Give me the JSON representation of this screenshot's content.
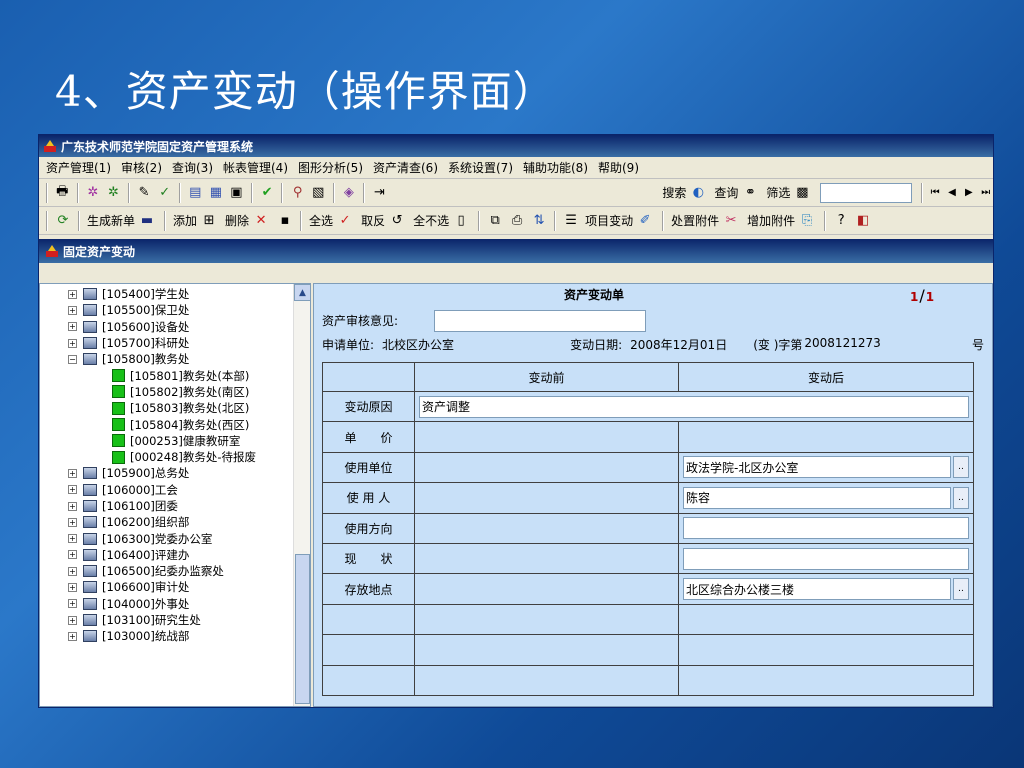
{
  "slide": {
    "title": "4、资产变动（操作界面）"
  },
  "window": {
    "title": "广东技术师范学院固定资产管理系统"
  },
  "menu": [
    "资产管理(1)",
    "审核(2)",
    "查询(3)",
    "帐表管理(4)",
    "图形分析(5)",
    "资产清查(6)",
    "系统设置(7)",
    "辅助功能(8)",
    "帮助(9)"
  ],
  "toolbar1": {
    "search_label": "搜索",
    "query_label": "查询",
    "filter_label": "筛选",
    "search_value": ""
  },
  "toolbar2": {
    "buttons": [
      "生成新单",
      "添加",
      "删除",
      "全选",
      "取反",
      "全不选",
      "项目变动",
      "处置附件",
      "增加附件"
    ]
  },
  "subwindow": {
    "title": "固定资产变动"
  },
  "tree": {
    "nodes": [
      {
        "label": "[105400]学生处",
        "type": "folder",
        "expand": "+"
      },
      {
        "label": "[105500]保卫处",
        "type": "folder",
        "expand": "+"
      },
      {
        "label": "[105600]设备处",
        "type": "folder",
        "expand": "+"
      },
      {
        "label": "[105700]科研处",
        "type": "folder",
        "expand": "+"
      },
      {
        "label": "[105800]教务处",
        "type": "folder",
        "expand": "−"
      },
      {
        "label": "[105801]教务处(本部)",
        "type": "leaf"
      },
      {
        "label": "[105802]教务处(南区)",
        "type": "leaf"
      },
      {
        "label": "[105803]教务处(北区)",
        "type": "leaf"
      },
      {
        "label": "[105804]教务处(西区)",
        "type": "leaf"
      },
      {
        "label": "[000253]健康教研室",
        "type": "leaf"
      },
      {
        "label": "[000248]教务处-待报废",
        "type": "leaf"
      },
      {
        "label": "[105900]总务处",
        "type": "folder",
        "expand": "+"
      },
      {
        "label": "[106000]工会",
        "type": "folder",
        "expand": "+"
      },
      {
        "label": "[106100]团委",
        "type": "folder",
        "expand": "+"
      },
      {
        "label": "[106200]组织部",
        "type": "folder",
        "expand": "+"
      },
      {
        "label": "[106300]党委办公室",
        "type": "folder",
        "expand": "+"
      },
      {
        "label": "[106400]评建办",
        "type": "folder",
        "expand": "+"
      },
      {
        "label": "[106500]纪委办监察处",
        "type": "folder",
        "expand": "+"
      },
      {
        "label": "[106600]审计处",
        "type": "folder",
        "expand": "+"
      },
      {
        "label": "[104000]外事处",
        "type": "folder",
        "expand": "+"
      },
      {
        "label": "[103100]研究生处",
        "type": "folder",
        "expand": "+"
      },
      {
        "label": "[103000]统战部",
        "type": "folder",
        "expand": "+"
      }
    ]
  },
  "form": {
    "title": "资产变动单",
    "page_current": "1",
    "page_total": "1",
    "opinion_label": "资产审核意见:",
    "opinion_value": "",
    "applicant_label": "申请单位:",
    "applicant_value": "北校区办公室",
    "change_date_label": "变动日期:",
    "change_date_value": "2008年12月01日",
    "doc_prefix": "(变 )字第",
    "doc_number": "2008121273",
    "doc_suffix": "号",
    "col_before": "变动前",
    "col_after": "变动后",
    "rows": [
      {
        "label": "变动原因",
        "before": "资产调整",
        "after": "",
        "kind": "wide"
      },
      {
        "label": "单　　价",
        "before": "",
        "after": "",
        "kind": "plain"
      },
      {
        "label": "使用单位",
        "before": "",
        "after": "政法学院-北区办公室",
        "kind": "lookup"
      },
      {
        "label": "使 用 人",
        "before": "",
        "after": "陈容",
        "kind": "lookup"
      },
      {
        "label": "使用方向",
        "before": "",
        "after": "",
        "kind": "input"
      },
      {
        "label": "现　　状",
        "before": "",
        "after": "",
        "kind": "input"
      },
      {
        "label": "存放地点",
        "before": "",
        "after": "北区综合办公楼三楼",
        "kind": "lookup"
      },
      {
        "label": "",
        "before": "",
        "after": "",
        "kind": "plain"
      },
      {
        "label": "",
        "before": "",
        "after": "",
        "kind": "plain"
      },
      {
        "label": "",
        "before": "",
        "after": "",
        "kind": "plain"
      }
    ]
  }
}
